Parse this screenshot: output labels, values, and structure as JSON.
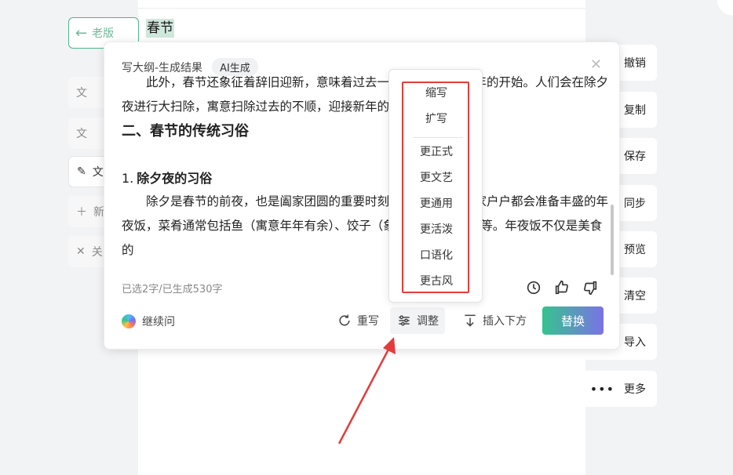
{
  "document": {
    "title": "春节"
  },
  "left_sidebar": {
    "old_version_label": "老版",
    "items": [
      "文",
      "文",
      "文",
      "新",
      "关"
    ]
  },
  "right_sidebar": {
    "items": [
      "撤销",
      "复制",
      "保存",
      "同步",
      "预览",
      "清空",
      "导入",
      "更多"
    ]
  },
  "panel": {
    "title": "写大纲-生成结果",
    "tag": "AI生成",
    "content": {
      "para1": "此外，春节还象征着辞旧迎新，意味着过去一年的结束和新一年的开始。人们会在除夕夜进行大扫除，寓意扫除过去的不顺，迎接新年的好运。",
      "heading2": "二、春节的传统习俗",
      "sub_num": "1.",
      "sub_heading": "除夕夜的习俗",
      "para2": "除夕是春节的前夜，也是阖家团圆的重要时刻。在这一天，家家户户都会准备丰盛的年夜饭，菜肴通常包括鱼（寓意年年有余）、饺子（象征团圆和财富）等。年夜饭不仅是美食的"
    },
    "stats": "已选2字/已生成530字",
    "continue_label": "继续问",
    "actions": {
      "rewrite": "重写",
      "adjust": "调整",
      "insert_below": "插入下方",
      "replace": "替换"
    }
  },
  "adjust_menu": {
    "items": [
      "缩写",
      "扩写",
      "更正式",
      "更文艺",
      "更通用",
      "更活泼",
      "口语化",
      "更古风"
    ]
  },
  "colors": {
    "accent_green": "#35c48d",
    "accent_purple": "#7b72e6",
    "highlight_red": "#e53b3b"
  }
}
